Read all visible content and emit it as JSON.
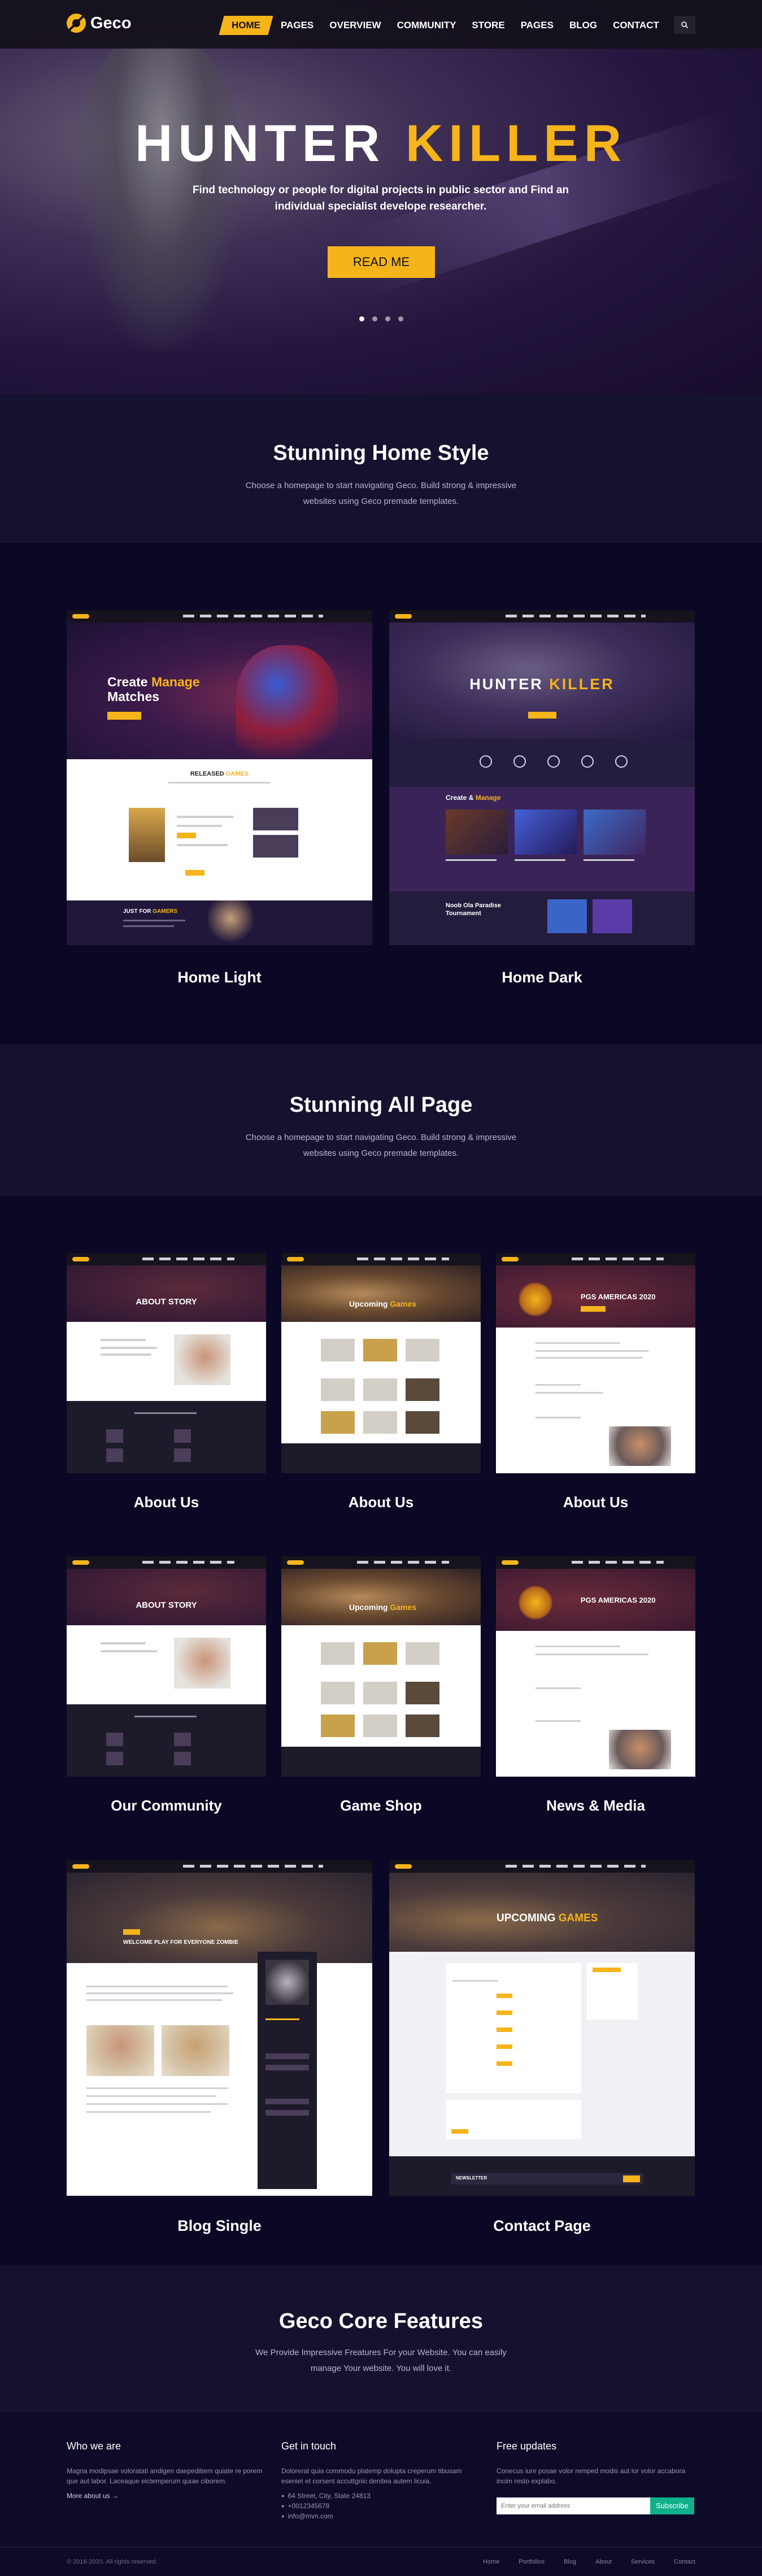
{
  "header": {
    "logo": "Geco",
    "nav": [
      "HOME",
      "PAGES",
      "OVERVIEW",
      "COMMUNITY",
      "STORE",
      "PAGES",
      "BLOG",
      "CONTACT"
    ],
    "search_icon": "search-icon"
  },
  "hero": {
    "title_white": "HUNTER",
    "title_gold": "KILLER",
    "subtitle": "Find technology or people for digital projects in public sector and Find an individual specialist develope researcher.",
    "button": "READ ME",
    "slides": 4
  },
  "home_style": {
    "title": "Stunning Home Style",
    "desc_line1": "Choose a homepage to start navigating Geco. Build strong & impressive",
    "desc_line2": "websites using Geco premade templates.",
    "cards": [
      {
        "label": "Home Light",
        "shot": {
          "hero_line1": "Create",
          "hero_gold": "Manage",
          "hero_line2": "Matches",
          "section": "RELEASED",
          "section_gold": "GAMES",
          "footer_title": "JUST FOR",
          "footer_gold": "GAMERS"
        }
      },
      {
        "label": "Home Dark",
        "shot": {
          "hero_white": "HUNTER",
          "hero_gold": "KILLER",
          "section": "Create &",
          "section_gold": "Manage",
          "bottom_title": "Noob Ola Paradise",
          "bottom_sub": "Tournament"
        }
      }
    ]
  },
  "all_page": {
    "title": "Stunning All Page",
    "desc_line1": "Choose a homepage to start navigating Geco. Build strong & impressive",
    "desc_line2": "websites using Geco premade templates.",
    "row1": [
      "About Us",
      "About Us",
      "About Us"
    ],
    "row2": [
      "Our Community",
      "Game Shop",
      "News & Media"
    ],
    "row3": [
      "Blog Single",
      "Contact Page"
    ],
    "shots": {
      "about": "ABOUT STORY",
      "upcoming": "Upcoming",
      "upcoming_gold": "Games",
      "pgs": "PGS AMERICAS 2020",
      "blog_banner": "WELCOME PLAY FOR EVERYONE ZOMBIE",
      "contact_banner": "UPCOMING",
      "contact_banner_gold": "GAMES",
      "newsletter": "NEWSLETTER"
    }
  },
  "features": {
    "title": "Geco Core Features",
    "desc_line1": "We Provide Impressive Freatures For your Website. You can easily",
    "desc_line2": "manage Your website. You will love it."
  },
  "footer": {
    "who": {
      "title": "Who we are",
      "text": "Magna modipsae voloratati andigen daepeditiem quiate re porem que aut labor. Laceaque eictemperum quiae ciborem.",
      "more": "More about us →"
    },
    "contact": {
      "title": "Get in touch",
      "text": "Dolorerat quia commodu platemp dolupta creperum tibusam eseniet et corsent accuttgnic denitea autem licuia.",
      "address": "64 Street, City, State 24813",
      "phone": "+0012345678",
      "email": "info@mvn.com"
    },
    "updates": {
      "title": "Free updates",
      "text": "Conecus iure posae volor remped modis aut lor volor accabora incim resto explabo.",
      "placeholder": "Enter your email address",
      "button": "Subscribe"
    },
    "copyright": "© 2016-2020. All rights reserved.",
    "links": [
      "Home",
      "Portfolios",
      "Blog",
      "About",
      "Services",
      "Contact"
    ]
  }
}
